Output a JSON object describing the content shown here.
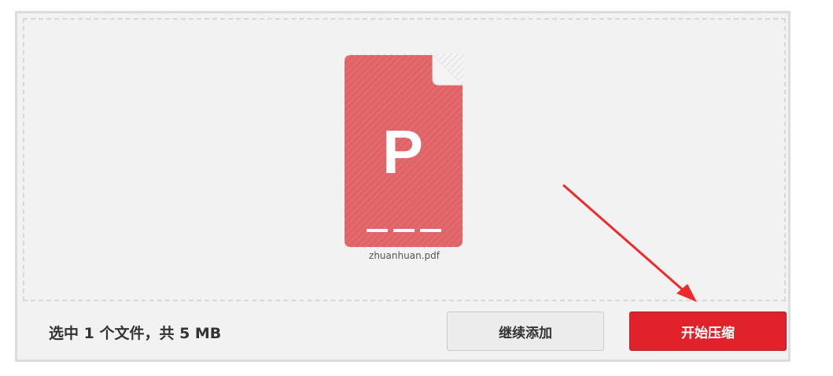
{
  "file": {
    "name": "zhuanhuan.pdf",
    "icon_letter": "P",
    "icon": "pdf-file-icon",
    "icon_color": "#e06367"
  },
  "footer": {
    "summary": "选中 1 个文件，共 5 MB",
    "add_more_label": "继续添加",
    "start_label": "开始压缩"
  },
  "colors": {
    "accent": "#e0232a",
    "annotation_arrow": "#ee2a2a"
  }
}
